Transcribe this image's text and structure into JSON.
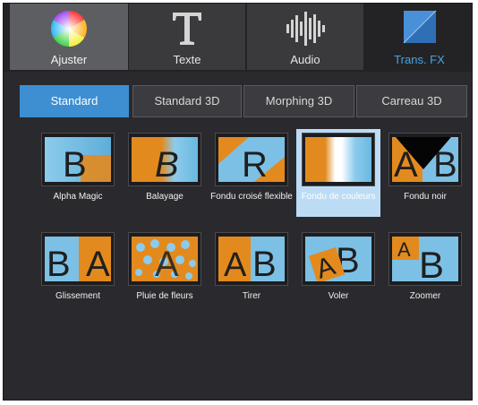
{
  "categories": [
    {
      "label": "Ajuster",
      "icon": "color-wheel-icon"
    },
    {
      "label": "Texte",
      "icon": "text-t-icon"
    },
    {
      "label": "Audio",
      "icon": "audio-waveform-icon"
    },
    {
      "label": "Trans. FX",
      "icon": "transition-fx-icon"
    }
  ],
  "active_category": "Trans. FX",
  "subtabs": [
    "Standard",
    "Standard 3D",
    "Morphing 3D",
    "Carreau 3D"
  ],
  "active_subtab": "Standard",
  "transitions": [
    {
      "label": "Alpha Magic"
    },
    {
      "label": "Balayage"
    },
    {
      "label": "Fondu croisé flexible"
    },
    {
      "label": "Fondu de couleurs"
    },
    {
      "label": "Fondu noir"
    },
    {
      "label": "Glissement"
    },
    {
      "label": "Pluie de fleurs"
    },
    {
      "label": "Tirer"
    },
    {
      "label": "Voler"
    },
    {
      "label": "Zoomer"
    }
  ],
  "selected_transition": "Fondu de couleurs",
  "colors": {
    "accent": "#3d8fd1",
    "thumb_blue": "#7cc0e6",
    "thumb_orange": "#e38a1e",
    "selection": "#bcdcf5"
  }
}
